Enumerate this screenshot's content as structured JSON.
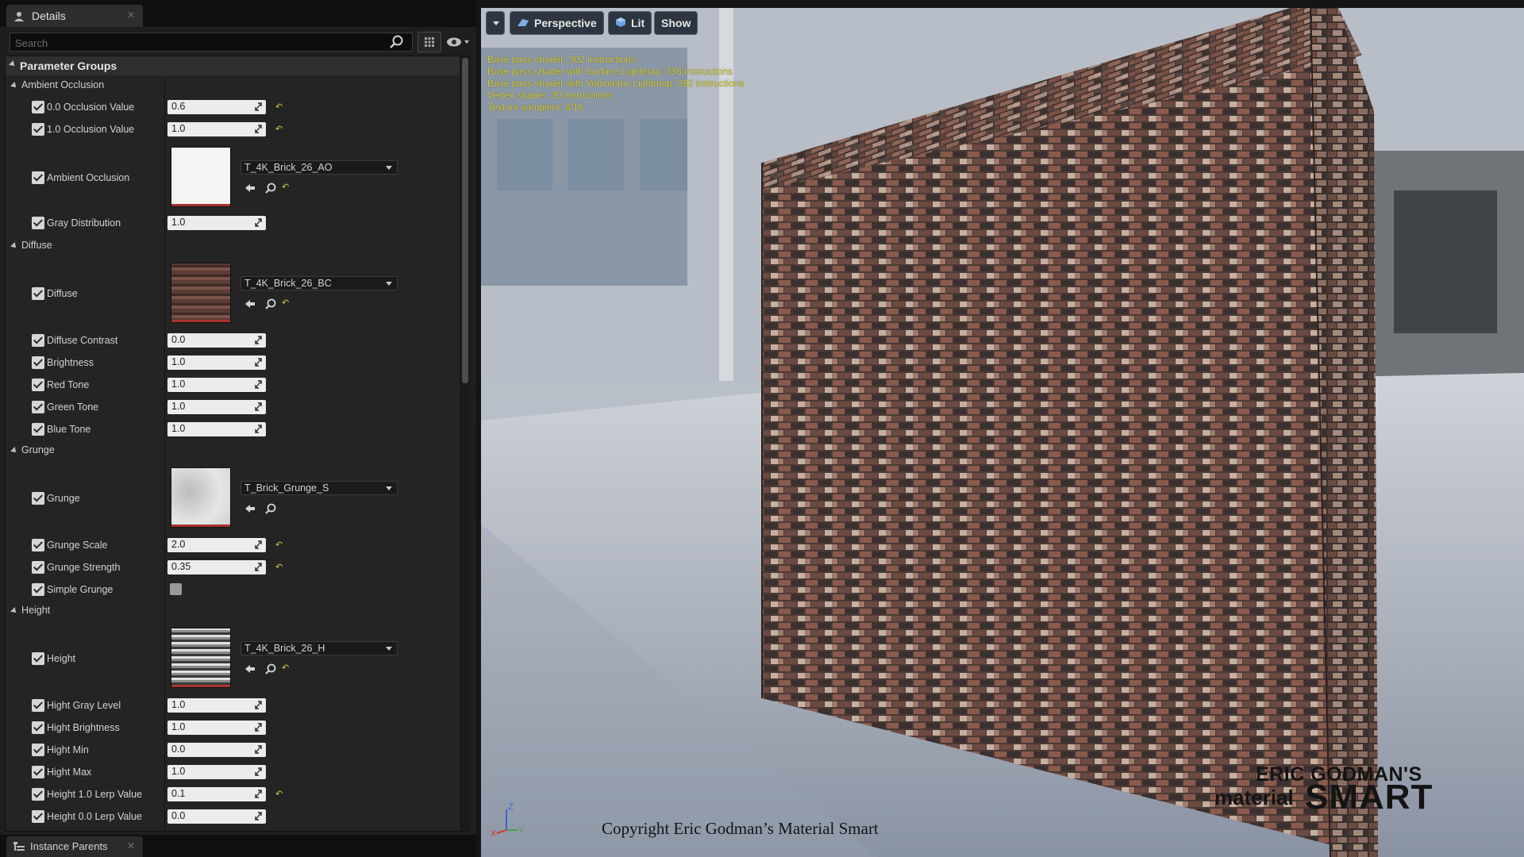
{
  "details_panel": {
    "tab": {
      "icon": "details-icon",
      "label": "Details"
    },
    "search": {
      "placeholder": "Search"
    },
    "parameter_groups_label": "Parameter Groups",
    "groups": {
      "ambient_occlusion": {
        "label": "Ambient Occlusion",
        "occ_0": {
          "label": "0.0 Occlusion Value",
          "value": "0.6"
        },
        "occ_1": {
          "label": "1.0 Occlusion Value",
          "value": "1.0"
        },
        "ao_texture": {
          "label": "Ambient Occlusion",
          "asset": "T_4K_Brick_26_AO"
        },
        "gray_distribution": {
          "label": "Gray Distribution",
          "value": "1.0"
        }
      },
      "diffuse": {
        "label": "Diffuse",
        "diffuse_texture": {
          "label": "Diffuse",
          "asset": "T_4K_Brick_26_BC"
        },
        "diffuse_contrast": {
          "label": "Diffuse Contrast",
          "value": "0.0"
        },
        "brightness": {
          "label": "Brightness",
          "value": "1.0"
        },
        "red_tone": {
          "label": "Red Tone",
          "value": "1.0"
        },
        "green_tone": {
          "label": "Green Tone",
          "value": "1.0"
        },
        "blue_tone": {
          "label": "Blue Tone",
          "value": "1.0"
        }
      },
      "grunge": {
        "label": "Grunge",
        "grunge_texture": {
          "label": "Grunge",
          "asset": "T_Brick_Grunge_S"
        },
        "grunge_scale": {
          "label": "Grunge Scale",
          "value": "2.0"
        },
        "grunge_strength": {
          "label": "Grunge Strength",
          "value": "0.35"
        },
        "simple_grunge": {
          "label": "Simple Grunge"
        }
      },
      "height": {
        "label": "Height",
        "height_texture": {
          "label": "Height",
          "asset": "T_4K_Brick_26_H"
        },
        "hight_gray_level": {
          "label": "Hight Gray Level",
          "value": "1.0"
        },
        "hight_brightness": {
          "label": "Hight Brightness",
          "value": "1.0"
        },
        "hight_min": {
          "label": "Hight Min",
          "value": "0.0"
        },
        "hight_max": {
          "label": "Hight Max",
          "value": "1.0"
        },
        "height_1_lerp": {
          "label": "Height 1.0 Lerp Value",
          "value": "0.1"
        },
        "height_0_lerp": {
          "label": "Height 0.0 Lerp Value",
          "value": "0.0"
        }
      }
    },
    "bottom_tab": {
      "icon": "hierarchy-icon",
      "label": "Instance Parents"
    }
  },
  "viewport": {
    "toolbar": {
      "perspective": {
        "icon": "perspective-icon",
        "label": "Perspective"
      },
      "lit": {
        "icon": "lit-cube-icon",
        "label": "Lit"
      },
      "show": {
        "label": "Show"
      }
    },
    "stats": [
      "Base pass shader: 302 instructions",
      "Base pass shader with Surface Lightmap: 336 instructions",
      "Base pass shader with Volumetric Lightmap: 392 instructions",
      "Vertex shader: 30 instructions",
      "Texture samplers: 6/16"
    ],
    "axis": {
      "z": "Z",
      "y": "Y",
      "x": "X"
    },
    "copyright": "Copyright Eric Godman’s Material Smart",
    "brand": {
      "line1": "ERIC GODMAN'S",
      "line2": "material",
      "line3": "SMART"
    }
  },
  "colors": {
    "stat_text": "#d8cf3a",
    "reset_arrow": "#d6c447",
    "thumb_underline": "#a8322e"
  }
}
